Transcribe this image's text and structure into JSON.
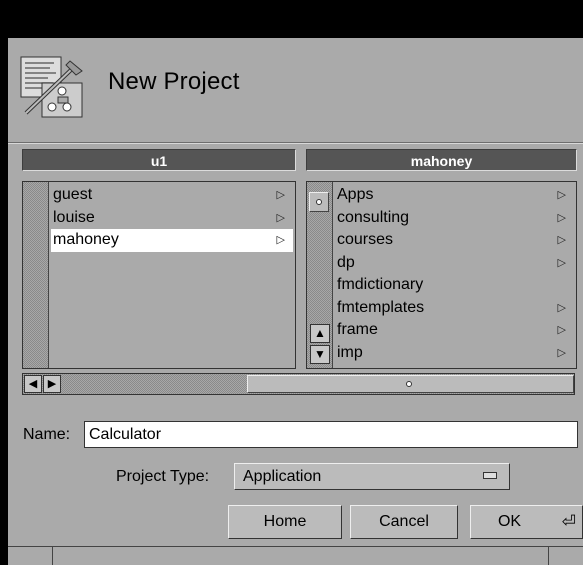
{
  "dialog": {
    "title": "New Project"
  },
  "columns": [
    {
      "header": "u1"
    },
    {
      "header": "mahoney"
    }
  ],
  "left_list": [
    {
      "label": "guest",
      "has_children": true,
      "selected": false
    },
    {
      "label": "louise",
      "has_children": true,
      "selected": false
    },
    {
      "label": "mahoney",
      "has_children": true,
      "selected": true
    }
  ],
  "right_list": [
    {
      "label": "Apps",
      "has_children": true
    },
    {
      "label": "consulting",
      "has_children": true
    },
    {
      "label": "courses",
      "has_children": true
    },
    {
      "label": "dp",
      "has_children": true
    },
    {
      "label": "fmdictionary",
      "has_children": false
    },
    {
      "label": "fmtemplates",
      "has_children": true
    },
    {
      "label": "frame",
      "has_children": true
    },
    {
      "label": "imp",
      "has_children": true
    }
  ],
  "form": {
    "name_label": "Name:",
    "name_value": "Calculator",
    "project_type_label": "Project Type:",
    "project_type_value": "Application"
  },
  "buttons": {
    "home": "Home",
    "cancel": "Cancel",
    "ok": "OK",
    "ok_icon": "⏎"
  },
  "glyphs": {
    "branch_arrow": "▷",
    "left_arrow": "◀",
    "right_arrow": "▶",
    "up_arrow": "▲",
    "down_arrow": "▼"
  }
}
